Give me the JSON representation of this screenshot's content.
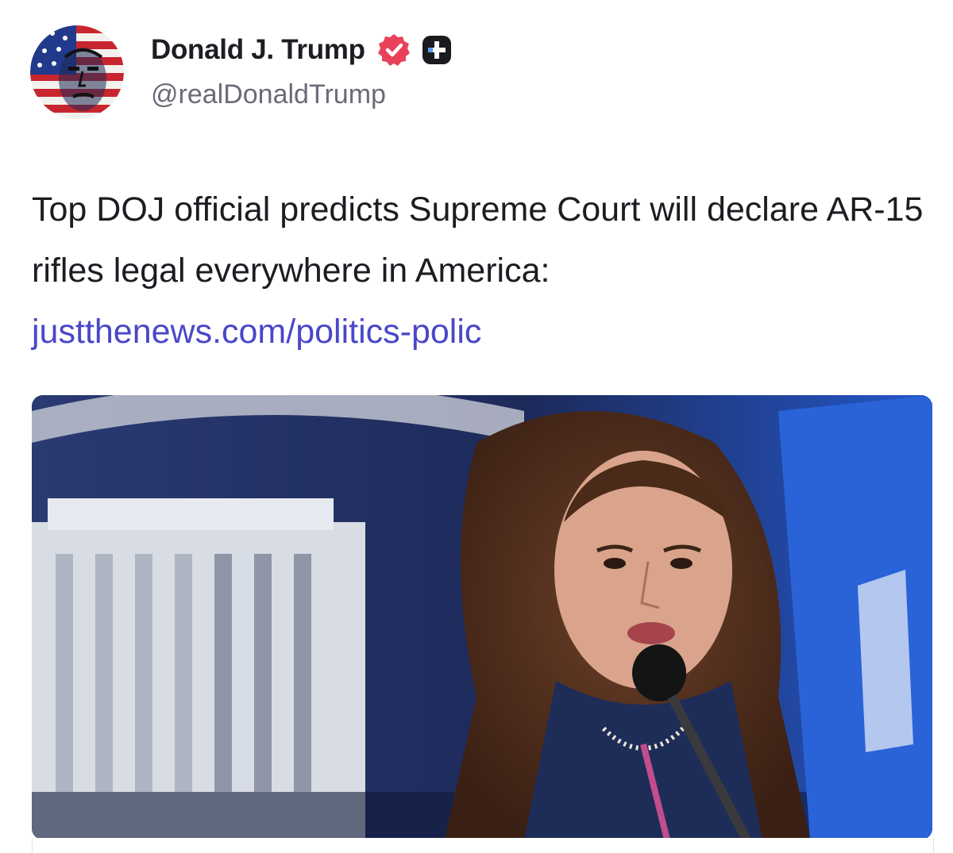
{
  "author": {
    "display_name": "Donald J. Trump",
    "handle": "@realDonaldTrump",
    "avatar_icon": "profile-avatar",
    "verified_icon": "verified-badge-icon",
    "extra_icon": "plus-badge-icon",
    "verified_color": "#e8425a"
  },
  "post": {
    "text": "Top DOJ official predicts Supreme Court will declare AR-15 rifles legal everywhere in America: ",
    "link_text": "justthenews.com/politics-polic",
    "link_color": "#4a47c9"
  },
  "link_card": {
    "image_icon": "article-photo"
  }
}
